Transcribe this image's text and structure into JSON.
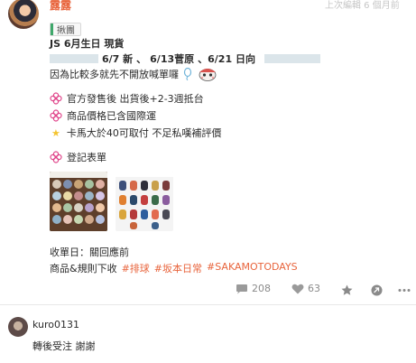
{
  "post": {
    "author": "露露",
    "edit_info": "上次編輯 6 個月前",
    "tag": "揪團",
    "lines": {
      "title": "JS 6月生日 現貨",
      "dates": {
        "d1": "6/7 新",
        "sep1": "、",
        "d2": "6/13菅原",
        "sep2": "、6/21 日向"
      },
      "note": "因為比較多就先不開放喊單囉",
      "bullet1": "官方發售後 出貨後+2-3週抵台",
      "bullet2": "商品價格已含國際運",
      "bullet3": "卡馬大於40可取付 不足私嘆補評價",
      "form_link": "登記表單",
      "deadline": "收單日：關回應前",
      "rules_prefix": "商品&規則下收",
      "hashtags": [
        "#排球",
        "#坂本日常",
        "#SAKAMOTODAYS"
      ]
    },
    "stats": {
      "comments": "208",
      "likes": "63"
    },
    "icons": {
      "comment": "comment-icon",
      "like": "heart-icon",
      "save": "star-icon",
      "share": "share-icon",
      "more": "more-icon",
      "flower": "flower-icon",
      "bullet_star": "star-bullet-icon"
    }
  },
  "comment": {
    "author": "kuro0131",
    "text": "轉後受注 謝謝"
  },
  "colors": {
    "accent": "#e8643c",
    "tag_bar": "#3fa86b",
    "flower": "#e0458a"
  }
}
